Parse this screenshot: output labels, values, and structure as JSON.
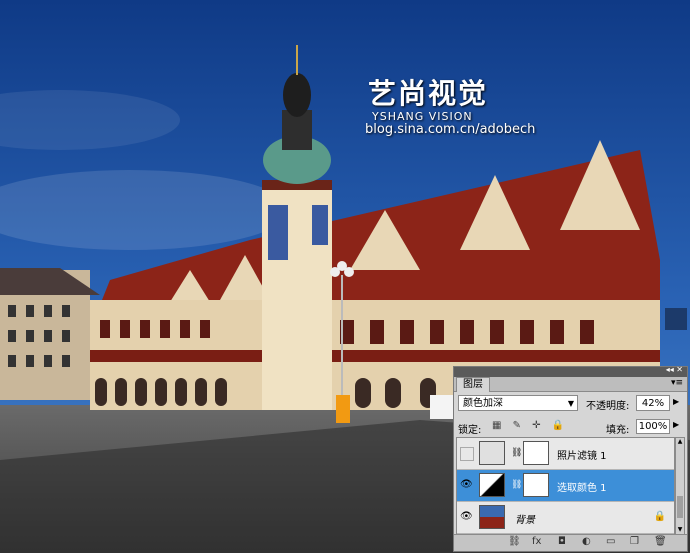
{
  "watermark": {
    "title": "艺尚视觉",
    "subtitle": "YSHANG VISION",
    "url": "blog.sina.com.cn/adobech"
  },
  "panel": {
    "tab_label": "图层",
    "blend_mode": "颜色加深",
    "opacity_label": "不透明度:",
    "opacity_value": "42%",
    "lock_label": "锁定:",
    "fill_label": "填充:",
    "fill_value": "100%",
    "layers": [
      {
        "name": "照片滤镜 1",
        "selected": false,
        "visible": false
      },
      {
        "name": "选取颜色 1",
        "selected": true,
        "visible": true
      },
      {
        "name": "背景",
        "selected": false,
        "visible": true,
        "locked": true
      }
    ]
  },
  "colors": {
    "sky": "#1e4e9a",
    "selection": "#3d8fd8",
    "roof": "#8c2418"
  }
}
